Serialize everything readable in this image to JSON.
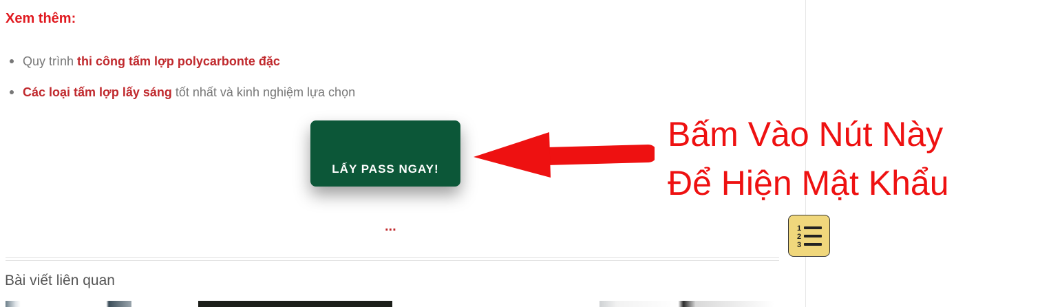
{
  "article": {
    "see_more": "Xem thêm:",
    "related_links": [
      {
        "before": "Quy trình ",
        "link": "thi công tấm lợp polycarbonte đặc",
        "after": ""
      },
      {
        "before": "",
        "link": "Các loại tấm lợp lấy sáng",
        "after": " tốt nhất và kinh nghiệm lựa chọn"
      }
    ],
    "get_pass_button": "LẤY PASS NGAY!",
    "ellipsis": "...",
    "related_heading": "Bài viết liên quan"
  },
  "annotation": {
    "line1": "Bấm Vào Nút Này",
    "line2": "Để Hiện Mật Khẩu",
    "color": "#ee1111"
  },
  "toc_button": {
    "icon": "numbered-list-icon",
    "color": "#f0d77c"
  },
  "colors": {
    "link": "#c0292d",
    "heading": "#e0191f",
    "button_bg": "#0c5738"
  }
}
